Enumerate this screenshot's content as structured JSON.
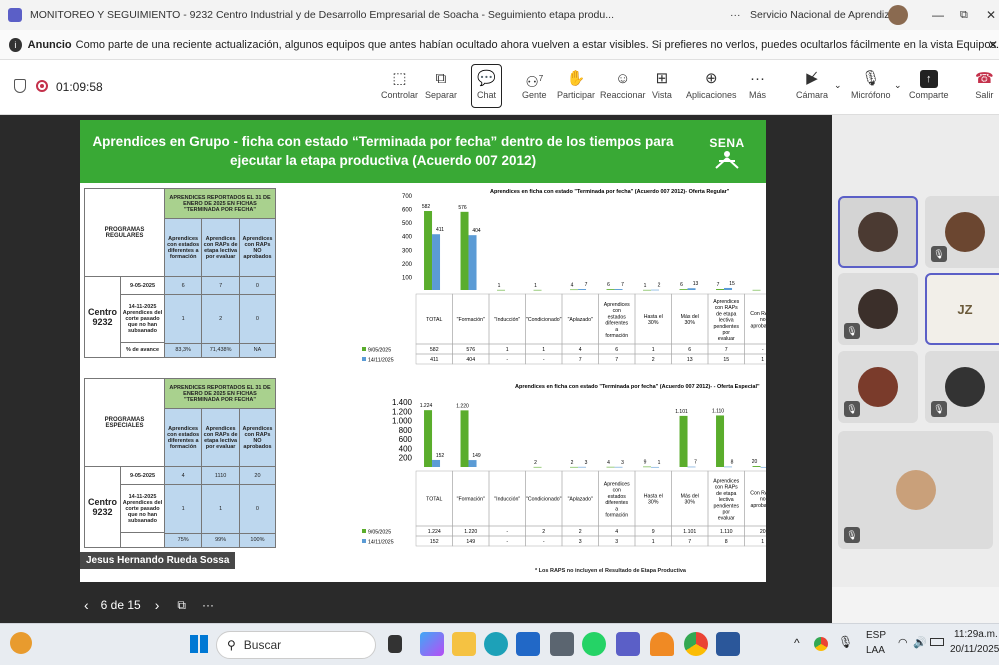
{
  "window": {
    "title": "MONITOREO Y SEGUIMIENTO - 9232 Centro Industrial y de Desarrollo Empresarial de Soacha - Seguimiento etapa produ...",
    "more": "···",
    "org": "Servicio Nacional de Aprendizaje"
  },
  "banner": {
    "bold": "Anuncio",
    "text": "Como parte de una reciente actualización, algunos equipos que antes habían ocultado ahora vuelven a estar visibles. Si prefieres no verlos, puedes ocultarlos fácilmente en la vista Equipos."
  },
  "call": {
    "timer": "01:09:58"
  },
  "toolbar": {
    "items": [
      "Controlar",
      "Separar",
      "Chat",
      "Gente",
      "Participar",
      "Reaccionar",
      "Vista",
      "Aplicaciones",
      "Más",
      "Cámara",
      "Micrófono",
      "Comparte",
      "Salir"
    ],
    "people_count": "7"
  },
  "slide": {
    "title": "Aprendices en Grupo - ficha con estado “Terminada por fecha” dentro de los tiempos para ejecutar la etapa productiva (Acuerdo 007 2012)",
    "logo": "SENA",
    "t1": {
      "header": "APRENDICES REPORTADOS EL 31 DE ENERO DE 2025 EN FICHAS \"TERMINADA POR FECHA\"",
      "section": "PROGRAMAS REGULARES",
      "cols": [
        "Aprendices con estados diferentes a formación",
        "Aprendices con RAPs de etapa lectiva por evaluar",
        "Aprendices con RAPs NO aprobados"
      ],
      "center": "Centro 9232",
      "r1_label": "9-05-2025",
      "r1": [
        "6",
        "7",
        "0"
      ],
      "r2_label": "14-11-2025 Aprendices del corte pasado que no han subsanado",
      "r2": [
        "1",
        "2",
        "0"
      ],
      "r3_label": "% de avance",
      "r3": [
        "83,3%",
        "71,438%",
        "NA"
      ]
    },
    "t2": {
      "header": "APRENDICES REPORTADOS EL 31 DE ENERO DE 2025 EN FICHAS \"TERMINADA POR FECHA\"",
      "section": "PROGRAMAS ESPECIALES",
      "cols": [
        "Aprendices con estados diferentes a formación",
        "Aprendices con RAPs de etapa lectiva por evaluar",
        "Aprendices con RAPs NO aprobados"
      ],
      "center": "Centro 9232",
      "r1_label": "9-05-2025",
      "r1": [
        "4",
        "1110",
        "20"
      ],
      "r2_label": "14-11-2025 Aprendices del corte pasado que no han subsanado",
      "r2": [
        "1",
        "1",
        "0"
      ],
      "r3": [
        "75%",
        "99%",
        "100%"
      ]
    },
    "footnote": "* Los RAPS no incluyen el Resultado de Etapa Productiva",
    "presenter": "Jesus Hernando Rueda Sossa"
  },
  "chart_data": [
    {
      "type": "bar",
      "title": "Aprendices en ficha con estado \"Terminada por fecha\" (Acuerdo 007 2012)- Oferta Regular\"",
      "categories": [
        "TOTAL",
        "\"Formación\"",
        "\"Inducción\"",
        "\"Condicionado\"",
        "\"Aplazado\"",
        "Aprendices con estados diferentes a formación",
        "Hasta el 30%",
        "Más del 30%",
        "Aprendices con RAPs de etapa lectiva pendientes por evaluar",
        "Con RAPS no aprobados"
      ],
      "series": [
        {
          "name": "9/05/2025",
          "color": "#5aad2c",
          "values": [
            582,
            576,
            1,
            1,
            4,
            6,
            1,
            6,
            7,
            1
          ]
        },
        {
          "name": "14/11/2025",
          "color": "#5b9bd5",
          "values": [
            411,
            404,
            null,
            null,
            7,
            7,
            2,
            13,
            15,
            null
          ]
        }
      ],
      "series_display": [
        [
          "582",
          "576",
          "1",
          "1",
          "4",
          "6",
          "1",
          "6",
          "7",
          "-"
        ],
        [
          "411",
          "404",
          "-",
          "-",
          "7",
          "7",
          "2",
          "13",
          "15",
          "1"
        ]
      ],
      "ylim": [
        0,
        700
      ],
      "yticks": [
        "700",
        "600",
        "500",
        "400",
        "300",
        "200",
        "100"
      ]
    },
    {
      "type": "bar",
      "title": "Aprendices en ficha con estado \"Terminada por fecha\" (Acuerdo 007 2012)- - Oferta Especial\"",
      "categories": [
        "TOTAL",
        "\"Formación\"",
        "\"Inducción\"",
        "\"Condicionado\"",
        "\"Aplazado\"",
        "Aprendices con estados diferentes a formación",
        "Hasta el 30%",
        "Más del 30%",
        "Aprendices con RAPs de etapa lectiva pendientes por evaluar",
        "Con RAPS no aprobados"
      ],
      "series": [
        {
          "name": "9/05/2025",
          "color": "#5aad2c",
          "values": [
            1224,
            1220,
            null,
            2,
            2,
            4,
            9,
            1101,
            1110,
            20
          ]
        },
        {
          "name": "14/11/2025",
          "color": "#5b9bd5",
          "values": [
            152,
            149,
            null,
            null,
            3,
            3,
            1,
            7,
            8,
            1
          ]
        }
      ],
      "series_display": [
        [
          "1.224",
          "1.220",
          "-",
          "2",
          "2",
          "4",
          "9",
          "1.101",
          "1.110",
          "20"
        ],
        [
          "152",
          "149",
          "-",
          "-",
          "3",
          "3",
          "1",
          "7",
          "8",
          "1"
        ]
      ],
      "ylim": [
        0,
        1400
      ],
      "yticks": [
        "1.400",
        "1.200",
        "1.000",
        "800",
        "600",
        "400",
        "200"
      ]
    }
  ],
  "participants": [
    {
      "initials": "",
      "color": "#4b3a32"
    },
    {
      "initials": "",
      "color": "#6b4630"
    },
    {
      "initials": "",
      "color": "#3b2f2a"
    },
    {
      "initials": "JZ",
      "color": "#e8dcc7"
    },
    {
      "initials": "",
      "color": "#7a3b2b"
    },
    {
      "initials": "",
      "color": "#333"
    },
    {
      "initials": "",
      "color": "#c9a07a"
    }
  ],
  "share": {
    "page": "6 de 15"
  },
  "taskbar": {
    "search": "Buscar",
    "lang1": "ESP",
    "lang2": "LAA",
    "time": "11:29a.m.",
    "date": "20/11/2025"
  }
}
